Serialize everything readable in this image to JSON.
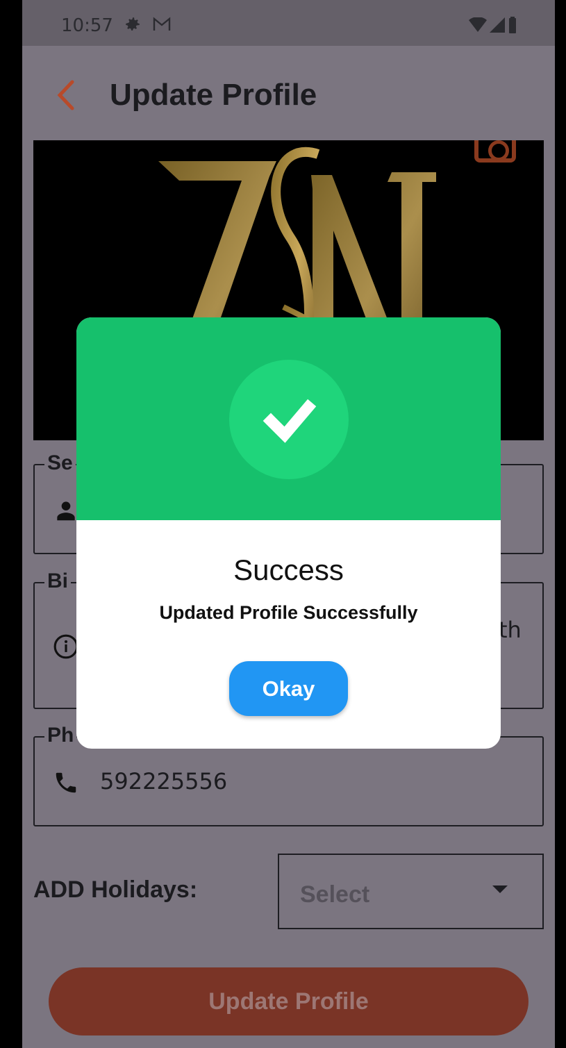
{
  "status_bar": {
    "time": "10:57",
    "icons": [
      "gear-icon",
      "gmail-icon",
      "wifi-icon",
      "signal-icon",
      "battery-icon"
    ]
  },
  "appbar": {
    "title": "Update Profile",
    "back_icon": "chevron-left-icon"
  },
  "fields": {
    "name": {
      "legend": "Se",
      "icon": "person-icon"
    },
    "bio": {
      "legend": "Bi",
      "icon": "info-icon",
      "partial_value": "th"
    },
    "phone": {
      "legend": "Ph",
      "icon": "phone-icon",
      "value": "592225556"
    }
  },
  "holidays": {
    "label": "ADD Holidays:",
    "select_value": "Select"
  },
  "primary_button": {
    "label": "Update Profile"
  },
  "dialog": {
    "title": "Success",
    "message": "Updated Profile Successfully",
    "button": "Okay",
    "icon": "checkmark-icon"
  },
  "colors": {
    "accent": "#b84a2a",
    "success": "#16c06c",
    "button_blue": "#2196f3"
  }
}
